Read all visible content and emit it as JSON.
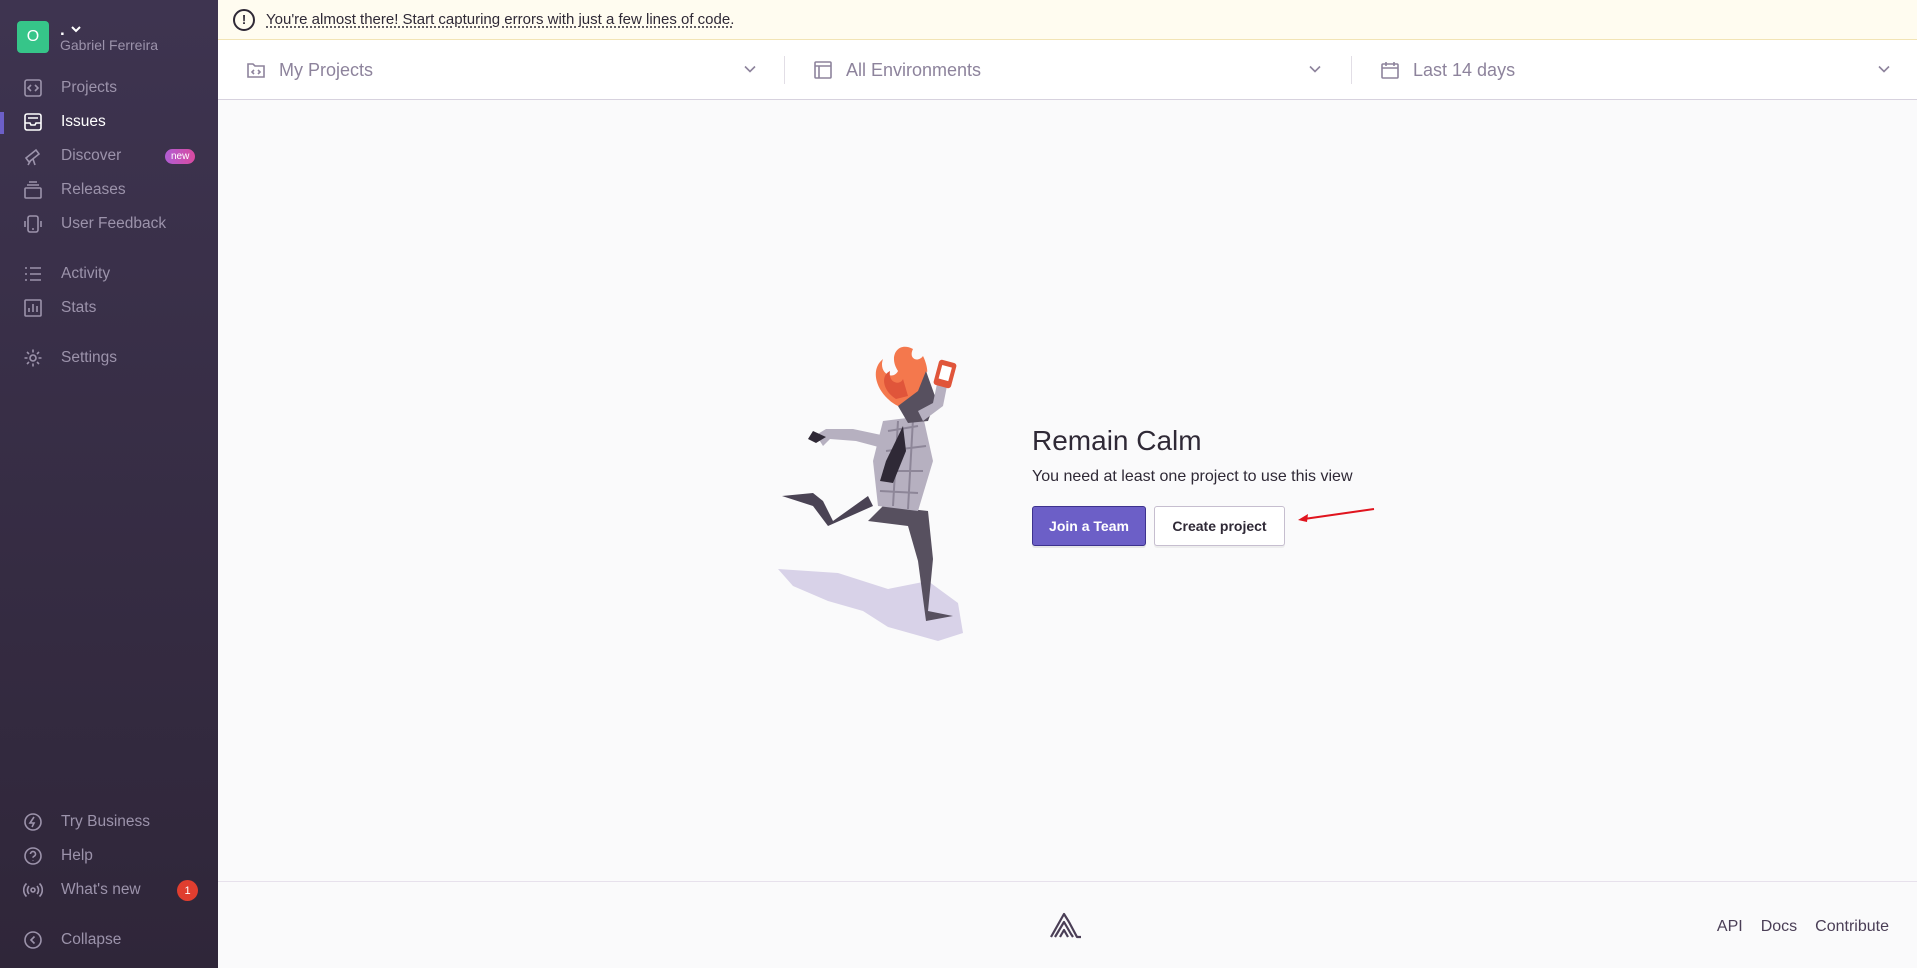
{
  "org": {
    "initial": "O",
    "name": ".",
    "user": "Gabriel Ferreira",
    "avatar_color": "#36c589"
  },
  "sidebar": {
    "items": [
      {
        "label": "Projects",
        "icon": "projects-icon"
      },
      {
        "label": "Issues",
        "icon": "issues-icon",
        "active": true
      },
      {
        "label": "Discover",
        "icon": "telescope-icon",
        "badge": "new"
      },
      {
        "label": "Releases",
        "icon": "releases-icon"
      },
      {
        "label": "User Feedback",
        "icon": "user-feedback-icon"
      },
      {
        "label": "Activity",
        "icon": "list-icon"
      },
      {
        "label": "Stats",
        "icon": "stats-icon"
      },
      {
        "label": "Settings",
        "icon": "gear-icon"
      }
    ],
    "bottom": [
      {
        "label": "Try Business",
        "icon": "lightning-icon"
      },
      {
        "label": "Help",
        "icon": "question-icon"
      },
      {
        "label": "What's new",
        "icon": "broadcast-icon",
        "count": "1"
      },
      {
        "label": "Collapse",
        "icon": "chevron-left-icon"
      }
    ]
  },
  "alert": {
    "icon": "!",
    "text": "You're almost there! Start capturing errors with just a few lines of code."
  },
  "filters": {
    "projects": "My Projects",
    "environments": "All Environments",
    "date": "Last 14 days"
  },
  "empty_state": {
    "title": "Remain Calm",
    "subtitle": "You need at least one project to use this view",
    "join_team": "Join a Team",
    "create_project": "Create project"
  },
  "footer": {
    "links": [
      "API",
      "Docs",
      "Contribute"
    ]
  },
  "colors": {
    "accent": "#6c5fc7",
    "sidebar_bg": "#3e3450",
    "badge_red": "#e03e2f",
    "annotation_arrow": "#e0141e"
  }
}
